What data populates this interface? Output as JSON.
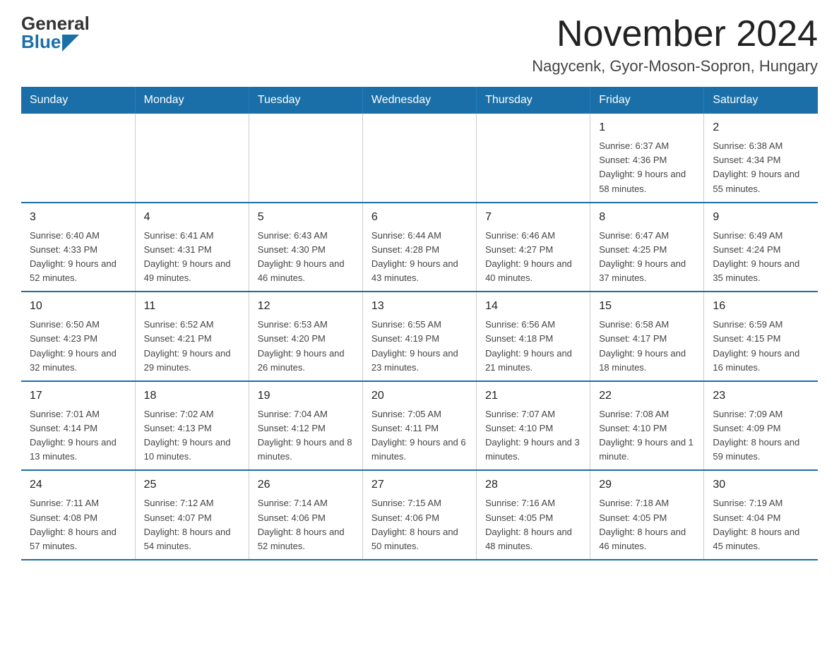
{
  "header": {
    "logo_general": "General",
    "logo_blue": "Blue",
    "month_title": "November 2024",
    "location": "Nagycenk, Gyor-Moson-Sopron, Hungary"
  },
  "days_of_week": [
    "Sunday",
    "Monday",
    "Tuesday",
    "Wednesday",
    "Thursday",
    "Friday",
    "Saturday"
  ],
  "weeks": [
    [
      {
        "day": "",
        "info": ""
      },
      {
        "day": "",
        "info": ""
      },
      {
        "day": "",
        "info": ""
      },
      {
        "day": "",
        "info": ""
      },
      {
        "day": "",
        "info": ""
      },
      {
        "day": "1",
        "info": "Sunrise: 6:37 AM\nSunset: 4:36 PM\nDaylight: 9 hours and 58 minutes."
      },
      {
        "day": "2",
        "info": "Sunrise: 6:38 AM\nSunset: 4:34 PM\nDaylight: 9 hours and 55 minutes."
      }
    ],
    [
      {
        "day": "3",
        "info": "Sunrise: 6:40 AM\nSunset: 4:33 PM\nDaylight: 9 hours and 52 minutes."
      },
      {
        "day": "4",
        "info": "Sunrise: 6:41 AM\nSunset: 4:31 PM\nDaylight: 9 hours and 49 minutes."
      },
      {
        "day": "5",
        "info": "Sunrise: 6:43 AM\nSunset: 4:30 PM\nDaylight: 9 hours and 46 minutes."
      },
      {
        "day": "6",
        "info": "Sunrise: 6:44 AM\nSunset: 4:28 PM\nDaylight: 9 hours and 43 minutes."
      },
      {
        "day": "7",
        "info": "Sunrise: 6:46 AM\nSunset: 4:27 PM\nDaylight: 9 hours and 40 minutes."
      },
      {
        "day": "8",
        "info": "Sunrise: 6:47 AM\nSunset: 4:25 PM\nDaylight: 9 hours and 37 minutes."
      },
      {
        "day": "9",
        "info": "Sunrise: 6:49 AM\nSunset: 4:24 PM\nDaylight: 9 hours and 35 minutes."
      }
    ],
    [
      {
        "day": "10",
        "info": "Sunrise: 6:50 AM\nSunset: 4:23 PM\nDaylight: 9 hours and 32 minutes."
      },
      {
        "day": "11",
        "info": "Sunrise: 6:52 AM\nSunset: 4:21 PM\nDaylight: 9 hours and 29 minutes."
      },
      {
        "day": "12",
        "info": "Sunrise: 6:53 AM\nSunset: 4:20 PM\nDaylight: 9 hours and 26 minutes."
      },
      {
        "day": "13",
        "info": "Sunrise: 6:55 AM\nSunset: 4:19 PM\nDaylight: 9 hours and 23 minutes."
      },
      {
        "day": "14",
        "info": "Sunrise: 6:56 AM\nSunset: 4:18 PM\nDaylight: 9 hours and 21 minutes."
      },
      {
        "day": "15",
        "info": "Sunrise: 6:58 AM\nSunset: 4:17 PM\nDaylight: 9 hours and 18 minutes."
      },
      {
        "day": "16",
        "info": "Sunrise: 6:59 AM\nSunset: 4:15 PM\nDaylight: 9 hours and 16 minutes."
      }
    ],
    [
      {
        "day": "17",
        "info": "Sunrise: 7:01 AM\nSunset: 4:14 PM\nDaylight: 9 hours and 13 minutes."
      },
      {
        "day": "18",
        "info": "Sunrise: 7:02 AM\nSunset: 4:13 PM\nDaylight: 9 hours and 10 minutes."
      },
      {
        "day": "19",
        "info": "Sunrise: 7:04 AM\nSunset: 4:12 PM\nDaylight: 9 hours and 8 minutes."
      },
      {
        "day": "20",
        "info": "Sunrise: 7:05 AM\nSunset: 4:11 PM\nDaylight: 9 hours and 6 minutes."
      },
      {
        "day": "21",
        "info": "Sunrise: 7:07 AM\nSunset: 4:10 PM\nDaylight: 9 hours and 3 minutes."
      },
      {
        "day": "22",
        "info": "Sunrise: 7:08 AM\nSunset: 4:10 PM\nDaylight: 9 hours and 1 minute."
      },
      {
        "day": "23",
        "info": "Sunrise: 7:09 AM\nSunset: 4:09 PM\nDaylight: 8 hours and 59 minutes."
      }
    ],
    [
      {
        "day": "24",
        "info": "Sunrise: 7:11 AM\nSunset: 4:08 PM\nDaylight: 8 hours and 57 minutes."
      },
      {
        "day": "25",
        "info": "Sunrise: 7:12 AM\nSunset: 4:07 PM\nDaylight: 8 hours and 54 minutes."
      },
      {
        "day": "26",
        "info": "Sunrise: 7:14 AM\nSunset: 4:06 PM\nDaylight: 8 hours and 52 minutes."
      },
      {
        "day": "27",
        "info": "Sunrise: 7:15 AM\nSunset: 4:06 PM\nDaylight: 8 hours and 50 minutes."
      },
      {
        "day": "28",
        "info": "Sunrise: 7:16 AM\nSunset: 4:05 PM\nDaylight: 8 hours and 48 minutes."
      },
      {
        "day": "29",
        "info": "Sunrise: 7:18 AM\nSunset: 4:05 PM\nDaylight: 8 hours and 46 minutes."
      },
      {
        "day": "30",
        "info": "Sunrise: 7:19 AM\nSunset: 4:04 PM\nDaylight: 8 hours and 45 minutes."
      }
    ]
  ]
}
